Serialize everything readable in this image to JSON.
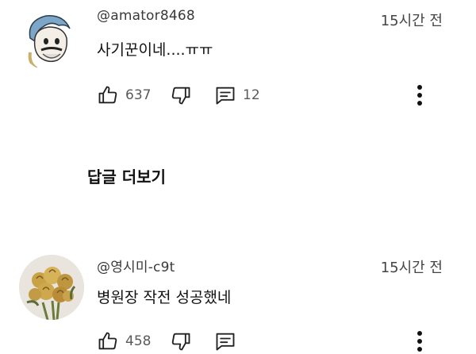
{
  "comments": [
    {
      "author": "@amator8468",
      "time": "15시간 전",
      "text": "사기꾼이네....ㅠㅠ",
      "likes": "637",
      "replies": "12",
      "avatar_icon": "cartoon-face-avatar"
    },
    {
      "author": "@영시미-c9t",
      "time": "15시간 전",
      "text": "병원장 작전 성공했네",
      "likes": "458",
      "replies": "",
      "avatar_icon": "flower-bouquet-avatar"
    }
  ],
  "more_replies_label": "답글 더보기",
  "icons": {
    "like": "thumb-up-icon",
    "dislike": "thumb-down-icon",
    "reply": "comment-icon",
    "menu": "more-vertical-icon"
  }
}
